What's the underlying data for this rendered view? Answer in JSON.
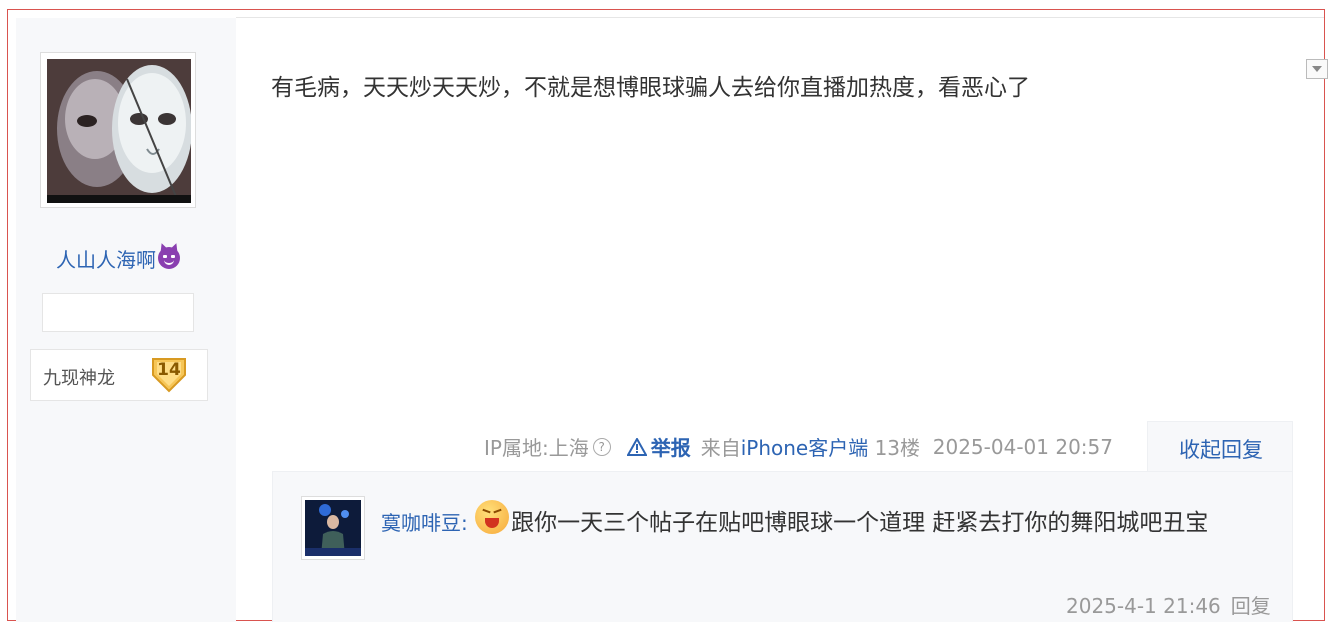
{
  "author": {
    "name": "人山人海啊",
    "name_emoji": "smiling-devil-emoji",
    "level_name": "九现神龙",
    "level": "14"
  },
  "post": {
    "text": "有毛病，天天炒天天炒，不就是想博眼球骗人去给你直播加热度，看恶心了",
    "ip": "IP属地:上海",
    "report": "举报",
    "source_prefix": "来自",
    "source_client": "iPhone客户端",
    "floor": "13楼",
    "time": "2025-04-01 20:57",
    "collapse_reply": "收起回复"
  },
  "reply": {
    "user": "寞咖啡豆",
    "separator": ":",
    "emoji": "laughing-face-emoji",
    "text": "跟你一天三个帖子在贴吧博眼球一个道理 赶紧去打你的舞阳城吧丑宝",
    "time": "2025-4-1 21:46",
    "reply_label": "回复"
  },
  "colors": {
    "link": "#2d64b3",
    "meta": "#999999",
    "sidebar_bg": "#f7f8fa",
    "frame": "#d9534f"
  }
}
